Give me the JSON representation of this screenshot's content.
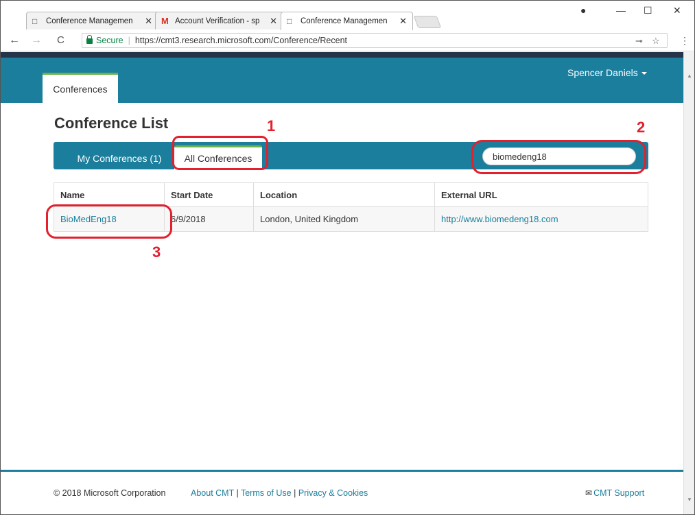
{
  "browser": {
    "tabs": [
      {
        "title": "Conference Managemen",
        "icon": "page-icon"
      },
      {
        "title": "Account Verification - sp",
        "icon": "gmail-icon"
      },
      {
        "title": "Conference Managemen",
        "icon": "page-icon"
      }
    ],
    "secure_label": "Secure",
    "url": "https://cmt3.research.microsoft.com/Conference/Recent"
  },
  "app": {
    "nav_tab": "Conferences",
    "user": "Spencer Daniels"
  },
  "main": {
    "title": "Conference List",
    "tabs": {
      "mine": "My Conferences (1)",
      "all": "All Conferences"
    },
    "search_value": "biomedeng18",
    "table": {
      "headers": [
        "Name",
        "Start Date",
        "Location",
        "External URL"
      ],
      "rows": [
        {
          "name": "BioMedEng18",
          "start_date": "6/9/2018",
          "location": "London, United Kingdom",
          "url": "http://www.biomedeng18.com"
        }
      ]
    }
  },
  "annotations": [
    "1",
    "2",
    "3"
  ],
  "footer": {
    "copyright": "© 2018 Microsoft Corporation",
    "about": "About CMT",
    "terms": "Terms of Use",
    "privacy": "Privacy & Cookies",
    "support": "CMT Support"
  },
  "colors": {
    "nav": "#1a7e9c",
    "accent_green": "#6eb24b",
    "annotation_red": "#e2202e",
    "top_stripe": "#253449"
  }
}
